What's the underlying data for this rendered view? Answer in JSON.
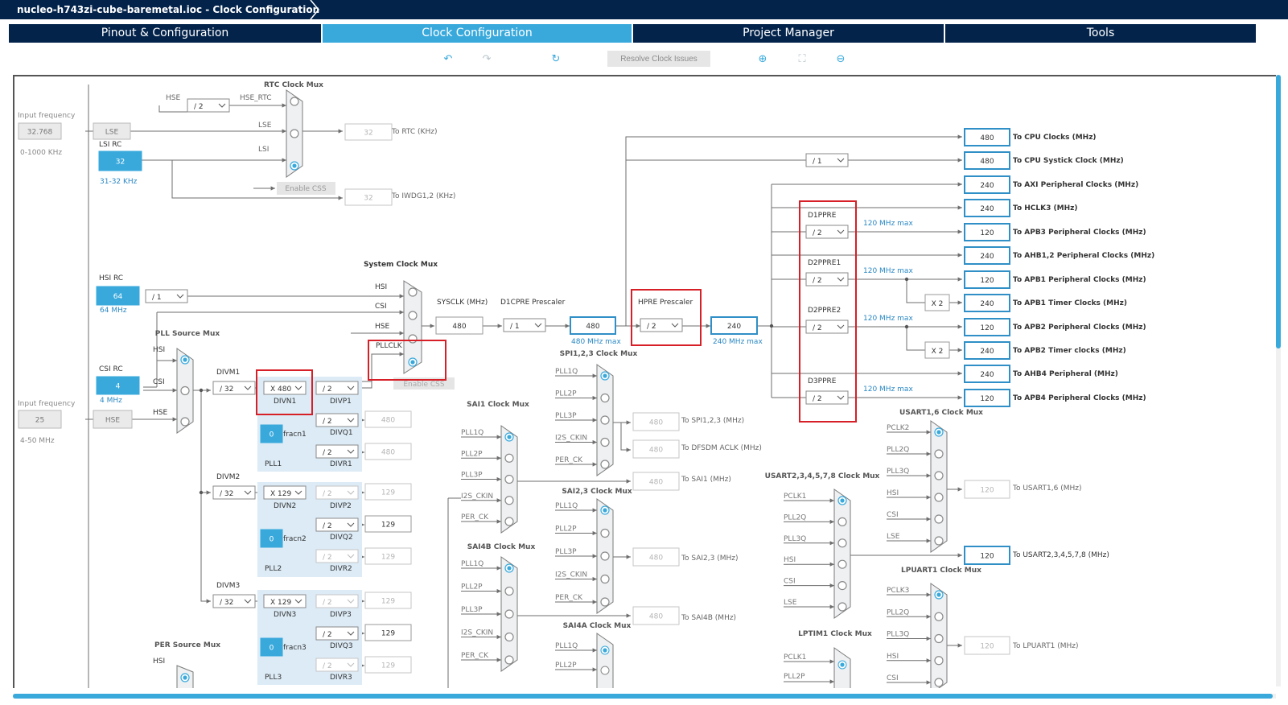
{
  "title": {
    "project": "nucleo-h743zi-cube-baremetal.ioc - Clock Configuration"
  },
  "tabs": {
    "pinout": "Pinout & Configuration",
    "clock": "Clock Configuration",
    "project": "Project Manager",
    "tools": "Tools"
  },
  "toolbar": {
    "resolve": "Resolve Clock Issues",
    "undo": "undo-icon",
    "redo": "redo-icon",
    "refresh": "refresh-icon",
    "zoom_in": "zoom-in-icon",
    "fit": "fit-icon",
    "zoom_out": "zoom-out-icon"
  },
  "colors": {
    "navy": "#03234b",
    "accent": "#39a9dc",
    "outline": "#2f8fc6",
    "highlight": "#d61f26"
  },
  "sources": {
    "lse": {
      "freq_label": "Input frequency",
      "value": "32.768",
      "range": "0-1000 KHz",
      "name": "LSE"
    },
    "lsi": {
      "name": "LSI RC",
      "value": "32",
      "range": "31-32 KHz"
    },
    "hsi": {
      "name": "HSI RC",
      "value": "64",
      "range": "64 MHz",
      "div": "/ 1"
    },
    "csi": {
      "name": "CSI RC",
      "value": "4",
      "range": "4 MHz"
    },
    "hse": {
      "freq_label": "Input frequency",
      "value": "25",
      "range": "4-50 MHz",
      "name": "HSE"
    }
  },
  "rtc": {
    "mux_title": "RTC Clock Mux",
    "hse_label": "HSE",
    "hse_div": "/ 2",
    "hse_rtc": "HSE_RTC",
    "lse_label": "LSE",
    "lsi_label": "LSI",
    "rtc_value": "32",
    "rtc_label": "To RTC (KHz)",
    "iwdg_value": "32",
    "iwdg_label": "To IWDG1,2 (KHz)",
    "css": "Enable CSS"
  },
  "sysmux": {
    "title": "System Clock Mux",
    "hsi": "HSI",
    "csi": "CSI",
    "hse": "HSE",
    "pllclk": "PLLCLK",
    "css": "Enable CSS",
    "sysclk_label": "SYSCLK (MHz)",
    "sysclk": "480",
    "d1cpre_label": "D1CPRE Prescaler",
    "d1cpre": "/ 1",
    "cpu": "480",
    "cpu_max": "480 MHz max",
    "hpre_label": "HPRE Prescaler",
    "hpre": "/ 2",
    "ahb": "240",
    "ahb_max": "240 MHz max"
  },
  "pll": {
    "src_title": "PLL Source Mux",
    "hsi": "HSI",
    "csi": "CSI",
    "hse": "HSE",
    "pll1": {
      "divm_label": "DIVM1",
      "divm": "/ 32",
      "divn": "X 480",
      "divn_label": "DIVN1",
      "frac": "0",
      "frac_label": "fracn1",
      "name": "PLL1",
      "divp": "/ 2",
      "divp_label": "DIVP1",
      "divq": "/ 2",
      "divq_label": "DIVQ1",
      "q_val": "480",
      "divr": "/ 2",
      "divr_label": "DIVR1",
      "r_val": "480"
    },
    "pll2": {
      "divm_label": "DIVM2",
      "divm": "/ 32",
      "divn": "X 129",
      "divn_label": "DIVN2",
      "frac": "0",
      "frac_label": "fracn2",
      "name": "PLL2",
      "divp": "/ 2",
      "divp_label": "DIVP2",
      "p_val": "129",
      "divq": "/ 2",
      "divq_label": "DIVQ2",
      "q_val": "129",
      "divr": "/ 2",
      "divr_label": "DIVR2",
      "r_val": "129"
    },
    "pll3": {
      "divm_label": "DIVM3",
      "divm": "/ 32",
      "divn": "X 129",
      "divn_label": "DIVN3",
      "frac": "0",
      "frac_label": "fracn3",
      "name": "PLL3",
      "divp": "/ 2",
      "divp_label": "DIVP3",
      "p_val": "129",
      "divq": "/ 2",
      "divq_label": "DIVQ3",
      "q_val": "129",
      "divr": "/ 2",
      "divr_label": "DIVR3",
      "r_val": "129"
    },
    "per_title": "PER Source Mux",
    "per_hsi": "HSI"
  },
  "periph": {
    "spi": {
      "title": "SPI1,2,3 Clock Mux",
      "inputs": [
        "PLL1Q",
        "PLL2P",
        "PLL3P",
        "I2S_CKIN",
        "PER_CK"
      ],
      "spi_val": "480",
      "spi_label": "To SPI1,2,3 (MHz)",
      "dfsdm_val": "480",
      "dfsdm_label": "To DFSDM ACLK (MHz)"
    },
    "sai1": {
      "title": "SAI1 Clock Mux",
      "inputs": [
        "PLL1Q",
        "PLL2P",
        "PLL3P",
        "I2S_CKIN",
        "PER_CK"
      ],
      "val": "480",
      "label": "To SAI1 (MHz)"
    },
    "sai23": {
      "title": "SAI2,3 Clock Mux",
      "inputs": [
        "PLL1Q",
        "PLL2P",
        "PLL3P",
        "I2S_CKIN",
        "PER_CK"
      ],
      "val": "480",
      "label": "To SAI2,3 (MHz)"
    },
    "sai4b": {
      "title": "SAI4B Clock Mux",
      "inputs": [
        "PLL1Q",
        "PLL2P",
        "PLL3P",
        "I2S_CKIN",
        "PER_CK"
      ],
      "val": "480",
      "label": "To SAI4B (MHz)"
    },
    "sai4a": {
      "title": "SAI4A Clock Mux",
      "inputs": [
        "PLL1Q",
        "PLL2P"
      ]
    },
    "usart16": {
      "title": "USART1,6 Clock Mux",
      "inputs": [
        "PCLK2",
        "PLL2Q",
        "PLL3Q",
        "HSI",
        "CSI",
        "LSE"
      ],
      "val": "120",
      "label": "To USART1,6 (MHz)"
    },
    "usart2": {
      "title": "USART2,3,4,5,7,8 Clock Mux",
      "inputs": [
        "PCLK1",
        "PLL2Q",
        "PLL3Q",
        "HSI",
        "CSI",
        "LSE"
      ],
      "val": "120",
      "label": "To USART2,3,4,5,7,8 (MHz)"
    },
    "lpuart": {
      "title": "LPUART1 Clock Mux",
      "inputs": [
        "PCLK3",
        "PLL2Q",
        "PLL3Q",
        "HSI",
        "CSI"
      ],
      "val": "120",
      "label": "To LPUART1 (MHz)"
    },
    "lptim": {
      "title": "LPTIM1 Clock Mux",
      "inputs": [
        "PCLK1",
        "PLL2P"
      ]
    }
  },
  "domain": {
    "d1ppre": {
      "label": "D1PPRE",
      "value": "/ 2",
      "max": "120 MHz max"
    },
    "d2ppre1": {
      "label": "D2PPRE1",
      "value": "/ 2",
      "max": "120 MHz max"
    },
    "d2ppre2": {
      "label": "D2PPRE2",
      "value": "/ 2",
      "max": "120 MHz max"
    },
    "d3ppre": {
      "label": "D3PPRE",
      "value": "/ 2",
      "max": "120 MHz max"
    },
    "systick_div": "/ 1",
    "x2a": "X 2",
    "x2b": "X 2"
  },
  "outputs": [
    {
      "value": "480",
      "label": "To CPU Clocks (MHz)"
    },
    {
      "value": "480",
      "label": "To CPU Systick Clock (MHz)"
    },
    {
      "value": "240",
      "label": "To AXI Peripheral Clocks (MHz)"
    },
    {
      "value": "240",
      "label": "To HCLK3 (MHz)"
    },
    {
      "value": "120",
      "label": "To APB3 Peripheral Clocks (MHz)"
    },
    {
      "value": "240",
      "label": "To AHB1,2 Peripheral Clocks (MHz)"
    },
    {
      "value": "120",
      "label": "To APB1 Peripheral Clocks (MHz)"
    },
    {
      "value": "240",
      "label": "To APB1 Timer Clocks (MHz)"
    },
    {
      "value": "120",
      "label": "To APB2 Peripheral Clocks (MHz)"
    },
    {
      "value": "240",
      "label": "To APB2 Timer clocks (MHz)"
    },
    {
      "value": "240",
      "label": "To AHB4 Peripheral (MHz)"
    },
    {
      "value": "120",
      "label": "To APB4 Peripheral Clocks (MHz)"
    }
  ]
}
